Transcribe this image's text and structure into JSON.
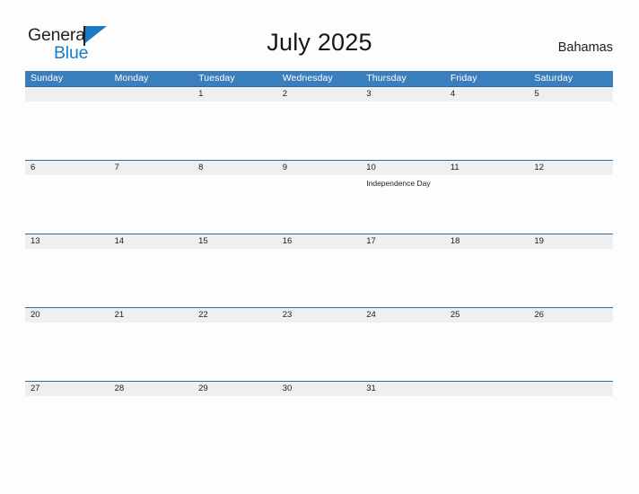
{
  "brand": {
    "name_part1": "General",
    "name_part2": "Blue",
    "flag_icon": "flag-triangle-icon",
    "part1_color": "#231f20",
    "part2_color": "#1a7bc4"
  },
  "header": {
    "title": "July 2025",
    "country": "Bahamas"
  },
  "colors": {
    "weekday_header_bg": "#3a7ebd",
    "weekday_header_text": "#ffffff",
    "row_separator": "#2b6ca3",
    "day_number_band_bg": "#efefef",
    "page_bg": "#fdfdfd",
    "body_text": "#1c1c1c"
  },
  "calendar": {
    "month": "July",
    "year": "2025",
    "weekdays": [
      "Sunday",
      "Monday",
      "Tuesday",
      "Wednesday",
      "Thursday",
      "Friday",
      "Saturday"
    ],
    "weeks": [
      [
        {
          "day": "",
          "event": ""
        },
        {
          "day": "",
          "event": ""
        },
        {
          "day": "1",
          "event": ""
        },
        {
          "day": "2",
          "event": ""
        },
        {
          "day": "3",
          "event": ""
        },
        {
          "day": "4",
          "event": ""
        },
        {
          "day": "5",
          "event": ""
        }
      ],
      [
        {
          "day": "6",
          "event": ""
        },
        {
          "day": "7",
          "event": ""
        },
        {
          "day": "8",
          "event": ""
        },
        {
          "day": "9",
          "event": ""
        },
        {
          "day": "10",
          "event": "Independence Day"
        },
        {
          "day": "11",
          "event": ""
        },
        {
          "day": "12",
          "event": ""
        }
      ],
      [
        {
          "day": "13",
          "event": ""
        },
        {
          "day": "14",
          "event": ""
        },
        {
          "day": "15",
          "event": ""
        },
        {
          "day": "16",
          "event": ""
        },
        {
          "day": "17",
          "event": ""
        },
        {
          "day": "18",
          "event": ""
        },
        {
          "day": "19",
          "event": ""
        }
      ],
      [
        {
          "day": "20",
          "event": ""
        },
        {
          "day": "21",
          "event": ""
        },
        {
          "day": "22",
          "event": ""
        },
        {
          "day": "23",
          "event": ""
        },
        {
          "day": "24",
          "event": ""
        },
        {
          "day": "25",
          "event": ""
        },
        {
          "day": "26",
          "event": ""
        }
      ],
      [
        {
          "day": "27",
          "event": ""
        },
        {
          "day": "28",
          "event": ""
        },
        {
          "day": "29",
          "event": ""
        },
        {
          "day": "30",
          "event": ""
        },
        {
          "day": "31",
          "event": ""
        },
        {
          "day": "",
          "event": ""
        },
        {
          "day": "",
          "event": ""
        }
      ]
    ]
  }
}
